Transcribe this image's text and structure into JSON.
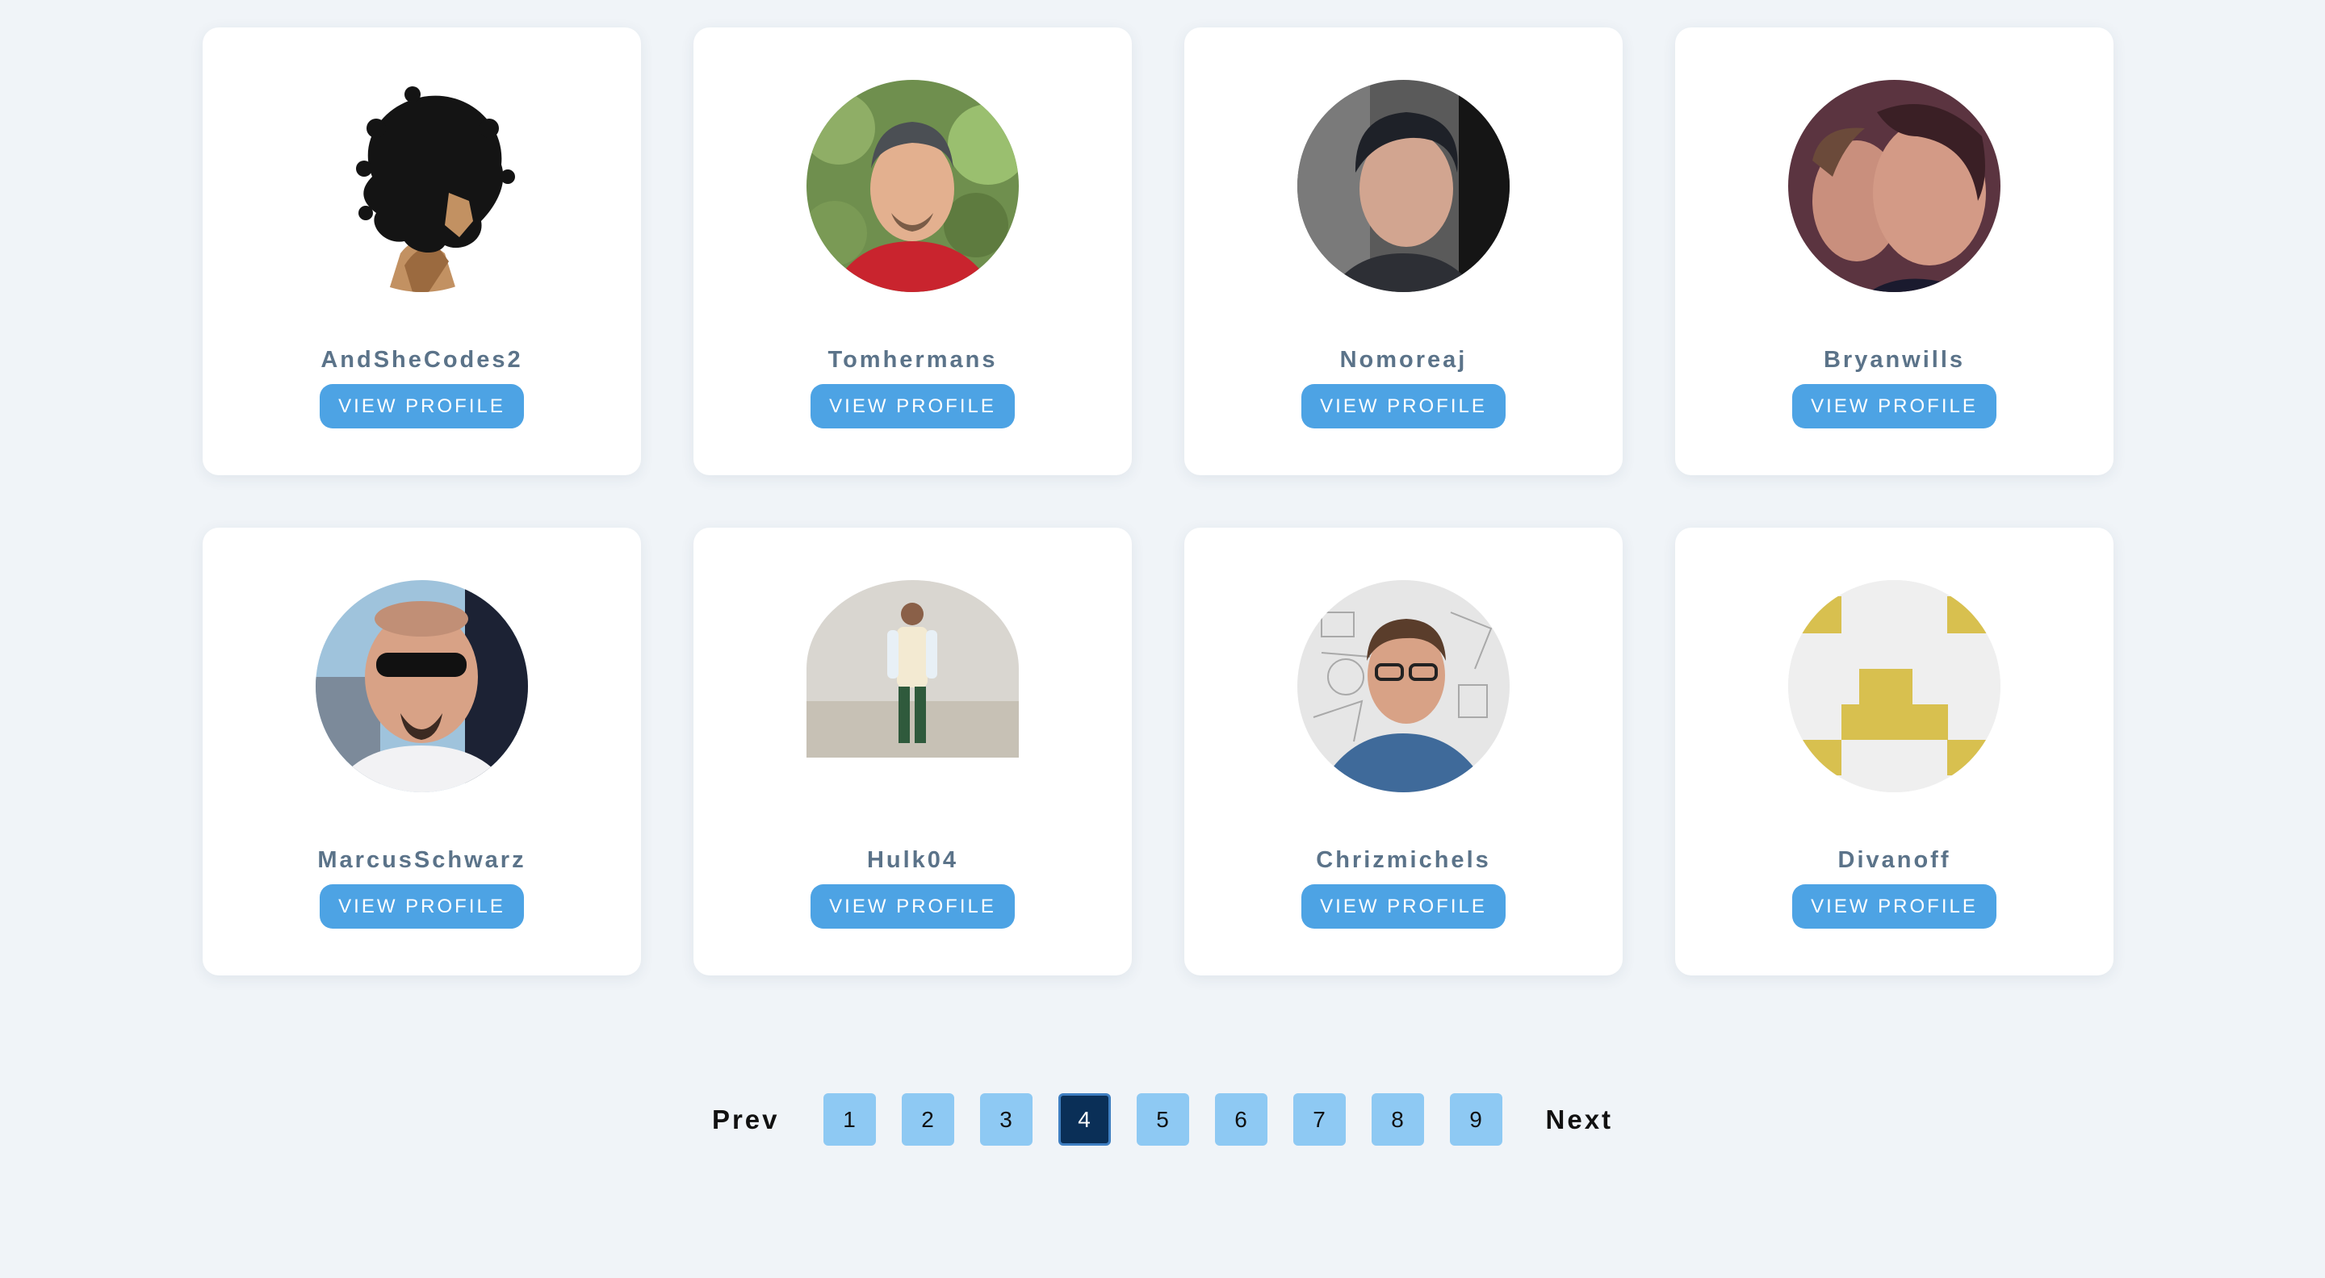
{
  "profiles": [
    {
      "username": "AndSheCodes2",
      "button_label": "VIEW PROFILE",
      "avatar_icon": "silhouette-curly-hair-icon"
    },
    {
      "username": "Tomhermans",
      "button_label": "VIEW PROFILE",
      "avatar_icon": "user-photo-avatar"
    },
    {
      "username": "Nomoreaj",
      "button_label": "VIEW PROFILE",
      "avatar_icon": "user-photo-avatar"
    },
    {
      "username": "Bryanwills",
      "button_label": "VIEW PROFILE",
      "avatar_icon": "user-photo-avatar"
    },
    {
      "username": "MarcusSchwarz",
      "button_label": "VIEW PROFILE",
      "avatar_icon": "user-photo-avatar"
    },
    {
      "username": "Hulk04",
      "button_label": "VIEW PROFILE",
      "avatar_icon": "user-photo-avatar"
    },
    {
      "username": "Chrizmichels",
      "button_label": "VIEW PROFILE",
      "avatar_icon": "user-photo-avatar"
    },
    {
      "username": "Divanoff",
      "button_label": "VIEW PROFILE",
      "avatar_icon": "identicon-avatar"
    }
  ],
  "pagination": {
    "prev_label": "Prev",
    "next_label": "Next",
    "pages": [
      "1",
      "2",
      "3",
      "4",
      "5",
      "6",
      "7",
      "8",
      "9"
    ],
    "current_page": "4"
  },
  "colors": {
    "background": "#f0f4f8",
    "button": "#4da3e4",
    "username_text": "#5b7389",
    "page_button": "#8ec9f3",
    "page_button_active": "#0a2f57",
    "identicon": "#d8c04f"
  }
}
